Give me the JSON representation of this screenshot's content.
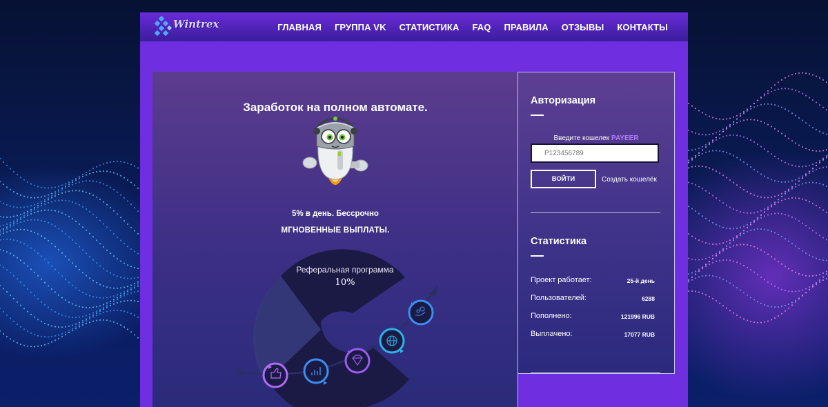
{
  "logo": {
    "text": "Wintrex"
  },
  "nav": {
    "items": [
      {
        "label": "ГЛАВНАЯ",
        "name": "nav-home"
      },
      {
        "label": "ГРУППА VK",
        "name": "nav-vk-group"
      },
      {
        "label": "СТАТИСТИКА",
        "name": "nav-statistics"
      },
      {
        "label": "FAQ",
        "name": "nav-faq"
      },
      {
        "label": "ПРАВИЛА",
        "name": "nav-rules"
      },
      {
        "label": "ОТЗЫВЫ",
        "name": "nav-reviews"
      },
      {
        "label": "КОНТАКТЫ",
        "name": "nav-contacts"
      }
    ]
  },
  "main": {
    "headline": "Заработок на полном автомате.",
    "tagline": "5% в день. Бессрочно",
    "payouts": "МГНОВЕННЫЕ ВЫПЛАТЫ.",
    "referral": {
      "title": "Реферальная программа",
      "value": "10%"
    },
    "steps": [
      {
        "icon": "thumbs-up-icon",
        "color": "#b06cf5"
      },
      {
        "icon": "bar-chart-icon",
        "color": "#3b8ff0"
      },
      {
        "icon": "diamond-icon",
        "color": "#9b5cf0"
      },
      {
        "icon": "globe-icon",
        "color": "#2ab3e8"
      },
      {
        "icon": "money-icon",
        "color": "#3b8ff0"
      }
    ]
  },
  "auth": {
    "title": "Авторизация",
    "wallet_label": "Введите кошелек",
    "wallet_brand": "PAYEER",
    "wallet_placeholder": "P123456789",
    "login_label": "ВОЙТИ",
    "create_wallet": "Создать кошелёк"
  },
  "stats": {
    "title": "Статистика",
    "rows": [
      {
        "label": "Проект работает:",
        "value": "25-й день"
      },
      {
        "label": "Пользователей:",
        "value": "6288"
      },
      {
        "label": "Пополнено:",
        "value": "121996 RUB"
      },
      {
        "label": "Выплачено:",
        "value": "17077 RUB"
      }
    ]
  }
}
